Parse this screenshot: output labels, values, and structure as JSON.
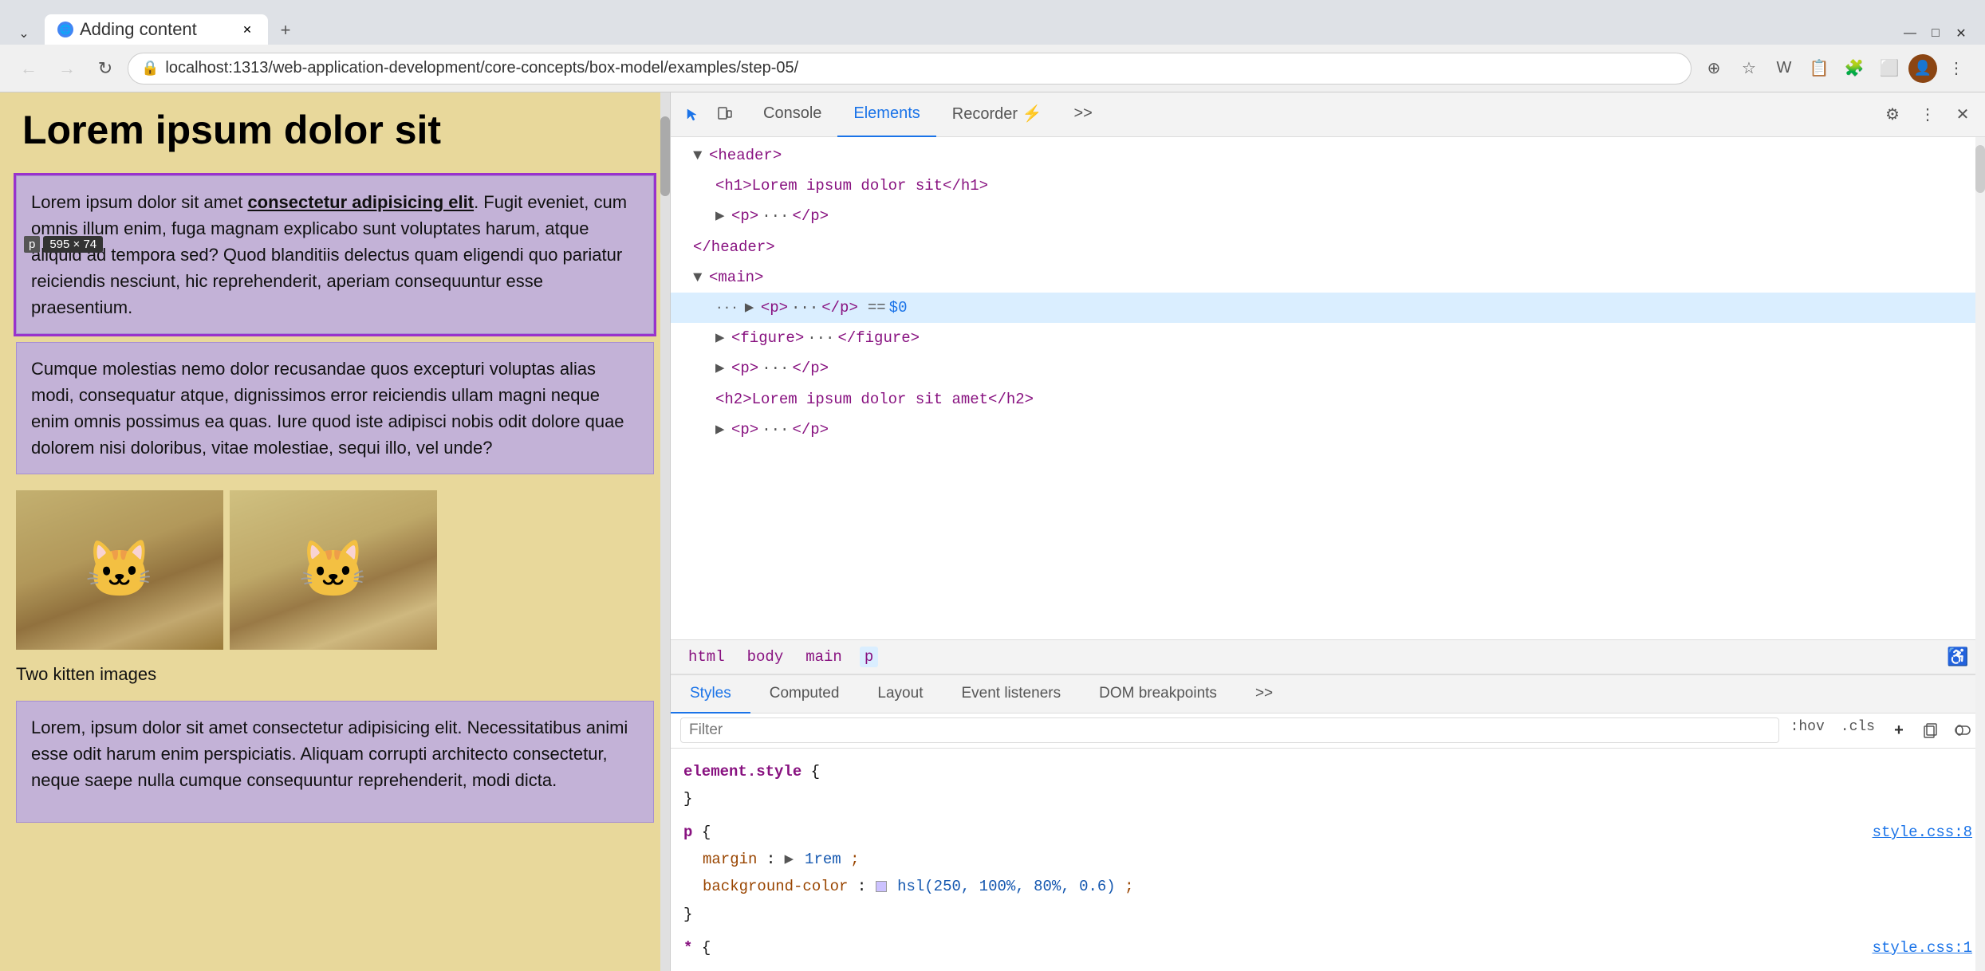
{
  "browser": {
    "tab_title": "Adding content",
    "tab_favicon": "🌐",
    "url": "localhost:1313/web-application-development/core-concepts/box-model/examples/step-05/",
    "new_tab_label": "+",
    "nav": {
      "back": "←",
      "forward": "→",
      "refresh": "↻"
    },
    "toolbar_icons": [
      "⊕",
      "★",
      "W",
      "📋",
      "🧩",
      "⬜",
      "👤",
      "⋮"
    ],
    "window_controls": {
      "minimize": "—",
      "maximize": "□",
      "close": "✕",
      "chevron": "⌄"
    }
  },
  "webpage": {
    "h1": "Lorem ipsum dolor sit",
    "para1": "Lorem ipsum dolor sit amet consectetur adipisicing elit. Fugit eveniet, cum omnis illum enim, fuga magnam explicabo sunt voluptates harum, atque aliquid ad tempora sed? Quod blanditiis delectus quam eligendi quo pariatur reiciendis nesciunt, hic reprehenderit, aperiam consequuntur esse praesentium.",
    "para1_strong": "consectetur adipisicing elit",
    "size_tooltip": "595 × 74",
    "p_label": "p",
    "para2": "Cumque molestias nemo dolor recusandae quos excepturi voluptas alias modi, consequatur atque, dignissimos error reiciendis ullam magni neque enim omnis possimus ea quas. Iure quod iste adipisci nobis odit dolore quae dolorem nisi doloribus, vitae molestiae, sequi illo, vel unde?",
    "figure_caption": "Two kitten images",
    "para3": "Lorem, ipsum dolor sit amet consectetur adipisicing elit. Necessitatibus animi esse odit harum enim perspiciatis. Aliquam corrupti architecto consectetur, neque saepe nulla cumque consequuntur reprehenderit, modi dicta."
  },
  "devtools": {
    "tabs": [
      "Console",
      "Elements",
      "Recorder ⚡",
      ">>"
    ],
    "active_tab": "Elements",
    "tool_icons": [
      "🔲",
      "⬛"
    ],
    "right_icons": [
      "⚙",
      "⋮",
      "✕"
    ],
    "dom_tree": {
      "lines": [
        {
          "indent": 1,
          "content": "▼ <header>",
          "type": "tag-open"
        },
        {
          "indent": 2,
          "content": "<h1>Lorem ipsum dolor sit</h1>",
          "type": "tag-inline"
        },
        {
          "indent": 2,
          "content": "▶ <p> ··· </p>",
          "type": "tag-collapsed"
        },
        {
          "indent": 1,
          "content": "</header>",
          "type": "tag-close"
        },
        {
          "indent": 1,
          "content": "▼ <main>",
          "type": "tag-open"
        },
        {
          "indent": 2,
          "content": "<p> ··· </p>  == $0",
          "type": "tag-selected"
        },
        {
          "indent": 2,
          "content": "▶ <figure> ··· </figure>",
          "type": "tag-collapsed"
        },
        {
          "indent": 2,
          "content": "▶ <p> ··· </p>",
          "type": "tag-collapsed"
        },
        {
          "indent": 2,
          "content": "<h2>Lorem ipsum dolor sit amet</h2>",
          "type": "tag-inline"
        },
        {
          "indent": 2,
          "content": "▶ <p> ··· </p>",
          "type": "tag-collapsed"
        }
      ]
    },
    "breadcrumbs": [
      "html",
      "body",
      "main",
      "p"
    ],
    "active_breadcrumb": "p",
    "styles": {
      "tabs": [
        "Styles",
        "Computed",
        "Layout",
        "Event listeners",
        "DOM breakpoints",
        ">>"
      ],
      "active_tab": "Styles",
      "filter_placeholder": "Filter",
      "filter_tags": [
        ":hov",
        ".cls"
      ],
      "rules": [
        {
          "selector": "element.style",
          "source": "",
          "properties": []
        },
        {
          "selector": "p",
          "source": "style.css:8",
          "properties": [
            {
              "name": "margin",
              "value": "▶ 1rem",
              "has_triangle": true
            },
            {
              "name": "background-color",
              "value": "hsl(250, 100%, 80%, 0.6)",
              "has_swatch": true,
              "swatch_color": "#b399ff"
            }
          ]
        },
        {
          "selector": "*",
          "source": "style.css:1",
          "properties": []
        }
      ]
    }
  }
}
